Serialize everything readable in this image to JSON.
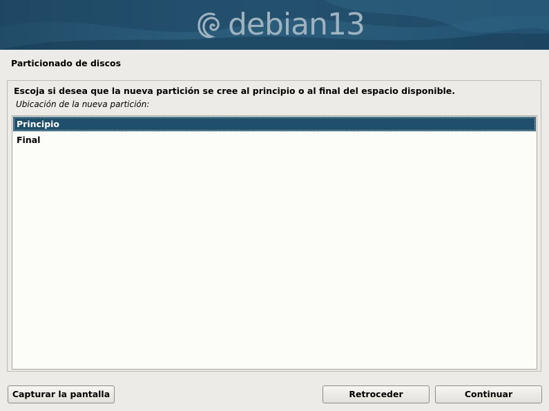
{
  "banner": {
    "logo_text": "debian13",
    "logo_icon": "debian-swirl-icon"
  },
  "header": {
    "title": "Particionado de discos"
  },
  "main": {
    "question": "Escoja si desea que la nueva partición se cree al principio o al final del espacio disponible.",
    "prompt": "Ubicación de la nueva partición:",
    "options": [
      {
        "label": "Principio",
        "selected": true
      },
      {
        "label": "Final",
        "selected": false
      }
    ]
  },
  "footer": {
    "screenshot_label": "Capturar la pantalla",
    "back_label": "Retroceder",
    "continue_label": "Continuar"
  },
  "colors": {
    "banner": "#2a5c7a",
    "selection": "#1f4f6b",
    "background": "#edebe7"
  }
}
